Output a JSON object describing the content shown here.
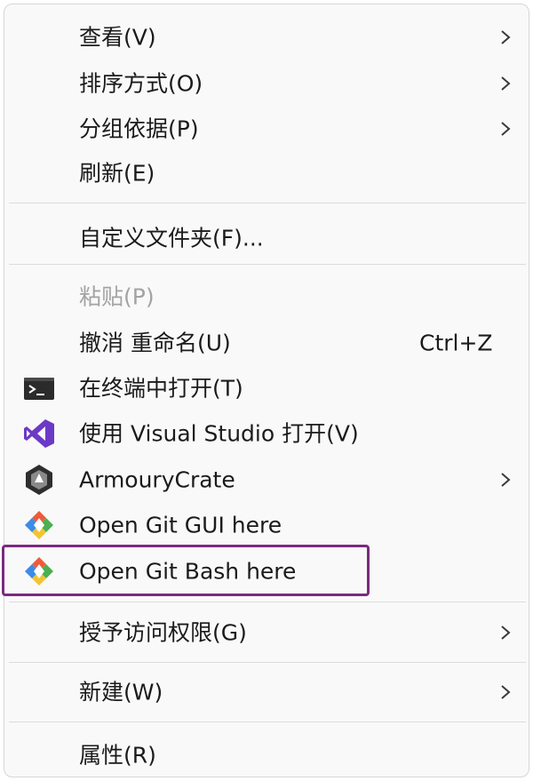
{
  "menu": {
    "view": {
      "label": "查看(V)"
    },
    "sort": {
      "label": "排序方式(O)"
    },
    "group": {
      "label": "分组依据(P)"
    },
    "refresh": {
      "label": "刷新(E)"
    },
    "customize": {
      "label": "自定义文件夹(F)..."
    },
    "paste": {
      "label": "粘贴(P)"
    },
    "undo": {
      "label": "撤消 重命名(U)",
      "shortcut": "Ctrl+Z"
    },
    "terminal": {
      "label": "在终端中打开(T)",
      "icon": "terminal-icon"
    },
    "vs": {
      "label": "使用 Visual Studio 打开(V)",
      "icon": "visual-studio-icon"
    },
    "armoury": {
      "label": "ArmouryCrate",
      "icon": "armoury-crate-icon"
    },
    "git_gui": {
      "label": "Open Git GUI here",
      "icon": "git-icon"
    },
    "git_bash": {
      "label": "Open Git Bash here",
      "icon": "git-icon"
    },
    "access": {
      "label": "授予访问权限(G)"
    },
    "new": {
      "label": "新建(W)"
    },
    "properties": {
      "label": "属性(R)"
    }
  },
  "colors": {
    "highlight_border": "#7a2a7e",
    "disabled_text": "#a3a3a3"
  }
}
